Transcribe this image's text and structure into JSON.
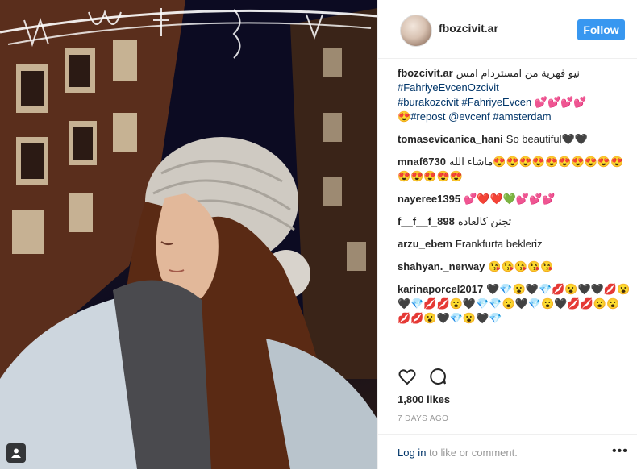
{
  "post": {
    "username": "fbozcivit.ar",
    "follow_label": "Follow",
    "caption": {
      "user": "fbozcivit.ar",
      "text": "نيو فهرية من امستردام امس",
      "line2": "#FahriyeEvcenOzcivit",
      "line3": "#burakozcivit #FahriyeEvcen",
      "line3_emoji": "💕💕💕💕",
      "line4_emoji": "😍",
      "line4": "#repost @evcenf #amsterdam"
    },
    "comments": [
      {
        "user": "tomasevicanica_hani",
        "text": "So beautiful🖤🖤"
      },
      {
        "user": "mnaf6730",
        "text": "ماشاء الله😍😍😍😍😍😍😍😍😍😍😍😍😍😍😍"
      },
      {
        "user": "nayeree1395",
        "text": "💕❤️❤️💚💕💕💕"
      },
      {
        "user": "f__f__f_898",
        "text": "تجنن كالعاده"
      },
      {
        "user": "arzu_ebem",
        "text": "Frankfurta bekleriz"
      },
      {
        "user": "shahyan._nerway",
        "text": "😘😘😘😘😘"
      },
      {
        "user": "karinaporcel2017",
        "text": "🖤💎😮🖤💎💋😮🖤🖤💋😮🖤💎💋💋😮🖤💎💎😮🖤💎😮🖤💋💋😮😮💋💋😮🖤💎😮🖤💎"
      }
    ],
    "likes": "1,800 likes",
    "date": "7 DAYS AGO",
    "login_link": "Log in",
    "login_rest": " to like or comment.",
    "more_label": "•••"
  },
  "colors": {
    "accent": "#3897f0",
    "link": "#003569",
    "muted": "#999999"
  }
}
